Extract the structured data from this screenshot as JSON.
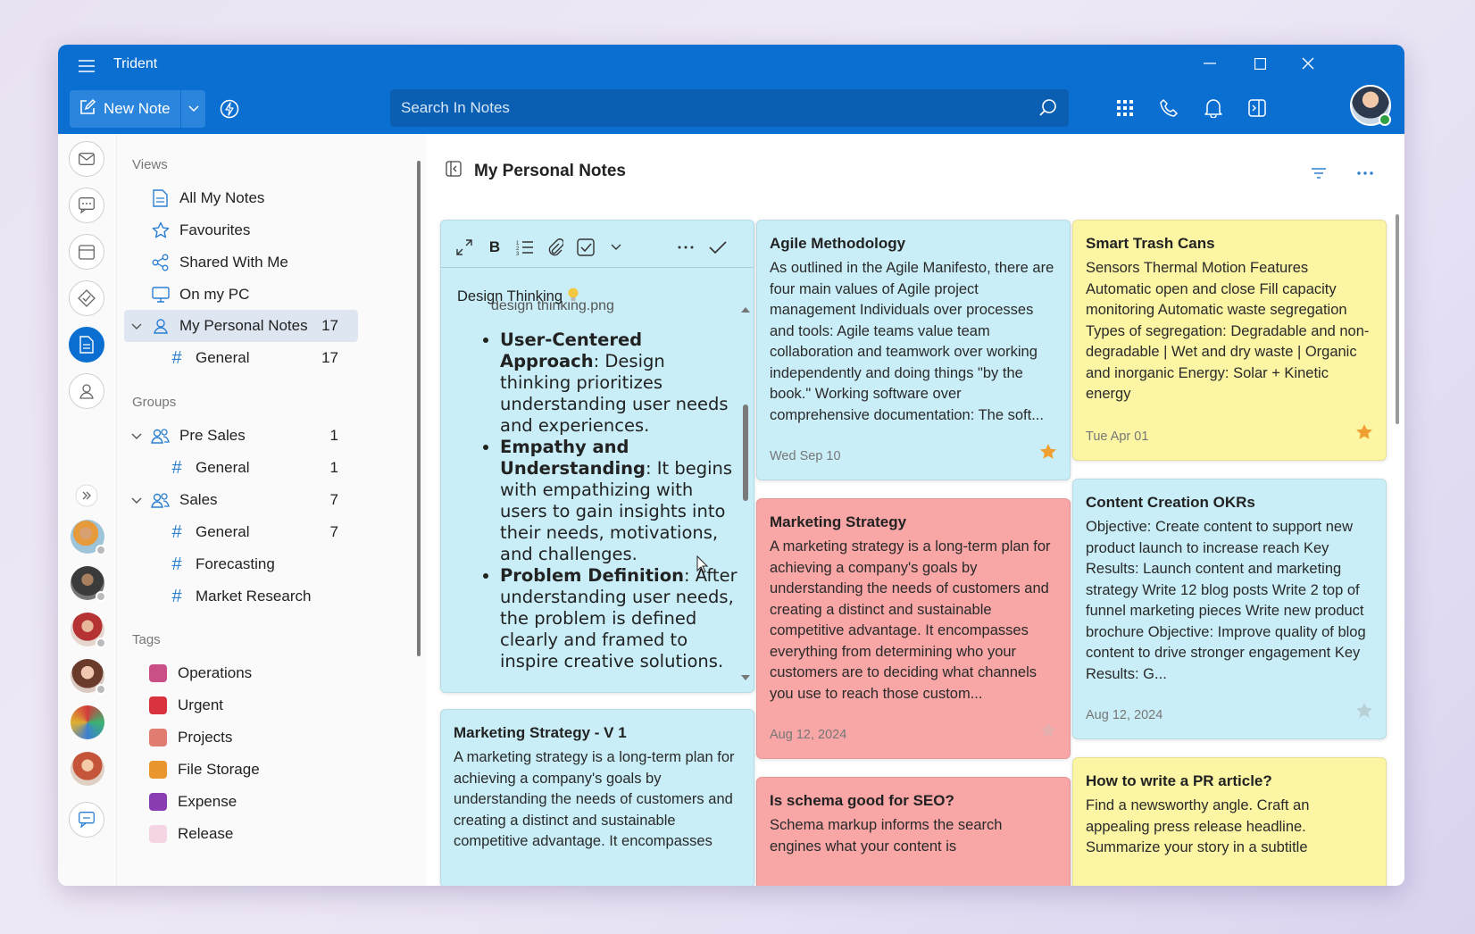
{
  "app": {
    "title": "Trident"
  },
  "toolbar": {
    "new_note_label": "New Note",
    "search_placeholder": "Search In Notes"
  },
  "nav": {
    "views_header": "Views",
    "views": [
      {
        "label": "All My Notes",
        "icon": "note-icon"
      },
      {
        "label": "Favourites",
        "icon": "star-outline-icon"
      },
      {
        "label": "Shared With Me",
        "icon": "share-icon"
      },
      {
        "label": "On my PC",
        "icon": "monitor-icon"
      }
    ],
    "personal": {
      "label": "My Personal Notes",
      "count": "17"
    },
    "personal_children": [
      {
        "label": "General",
        "count": "17"
      }
    ],
    "groups_header": "Groups",
    "groups": [
      {
        "label": "Pre Sales",
        "count": "1",
        "children": [
          {
            "label": "General",
            "count": "1"
          }
        ]
      },
      {
        "label": "Sales",
        "count": "7",
        "children": [
          {
            "label": "General",
            "count": "7"
          },
          {
            "label": "Forecasting",
            "count": ""
          },
          {
            "label": "Market Research",
            "count": ""
          }
        ]
      }
    ],
    "tags_header": "Tags",
    "tags": [
      {
        "label": "Operations",
        "color": "#c94f86"
      },
      {
        "label": "Urgent",
        "color": "#d9333f"
      },
      {
        "label": "Projects",
        "color": "#e07c70"
      },
      {
        "label": "File Storage",
        "color": "#e9962e"
      },
      {
        "label": "Expense",
        "color": "#8a3db3"
      },
      {
        "label": "Release",
        "color": "#f5d4e4"
      }
    ]
  },
  "content": {
    "title": "My Personal Notes",
    "editor": {
      "title": "Design Thinking",
      "image_alt": "design thinking.png",
      "bullets": [
        {
          "bold": "User-Centered Approach",
          "text": ": Design thinking prioritizes understanding user needs and experiences."
        },
        {
          "bold": "Empathy and Understanding",
          "text": ": It begins with empathizing with users to gain insights into their needs, motivations, and challenges."
        },
        {
          "bold": "Problem Definition",
          "text": ": After understanding user needs, the problem is defined clearly and framed to inspire creative solutions."
        }
      ]
    },
    "cards": [
      {
        "title": "Agile Methodology",
        "body": "As outlined in the Agile Manifesto, there are four main values of Agile project management Individuals over processes and tools: Agile teams value team collaboration and teamwork over working independently and doing things \"by the book.\" Working software over comprehensive documentation: The soft...",
        "date": "Wed Sep 10",
        "starred": true,
        "color": "#c9eef7"
      },
      {
        "title": "Smart Trash Cans",
        "body": "Sensors Thermal Motion Features Automatic open and close Fill capacity monitoring Automatic waste segregation Types of segregation: Degradable and non-degradable | Wet and dry waste | Organic and inorganic Energy: Solar + Kinetic energy",
        "date": "Tue Apr 01",
        "starred": true,
        "color": "#fbf5a4"
      },
      {
        "title": "Marketing Strategy",
        "body": "A marketing strategy is a long-term plan for achieving a company's goals by understanding the needs of customers and creating a distinct and sustainable competitive advantage. It encompasses everything from determining who your customers are to deciding what channels you use to reach those custom...",
        "date": "Aug 12, 2024",
        "starred": false,
        "color": "#f8a6a6"
      },
      {
        "title": "Content Creation OKRs",
        "body": "Objective: Create content to support new product launch to increase reach Key Results: Launch content and marketing strategy Write 12 blog posts Write 2 top of funnel marketing pieces Write new product brochure Objective: Improve quality of blog content to drive stronger engagement Key Results: G...",
        "date": "Aug 12, 2024",
        "starred": false,
        "color": "#c9eef7"
      },
      {
        "title": "Marketing Strategy - V 1",
        "body": "A marketing strategy is a long-term plan for achieving a company's goals by understanding the needs of customers and creating a distinct and sustainable competitive advantage. It encompasses",
        "date": "",
        "starred": false,
        "color": "#c9eef7"
      },
      {
        "title": "Is schema good for SEO?",
        "body": "Schema markup informs the search engines what your content is",
        "date": "",
        "starred": false,
        "color": "#f8a6a6"
      },
      {
        "title": "How to write a PR article?",
        "body": "Find a newsworthy angle. Craft an appealing press release headline. Summarize your story in a subtitle",
        "date": "",
        "starred": false,
        "color": "#fbf5a4"
      }
    ]
  },
  "colors": {
    "accent": "#0a6fd1",
    "star_on": "#f0a030",
    "star_off": "#c8c8c8"
  }
}
